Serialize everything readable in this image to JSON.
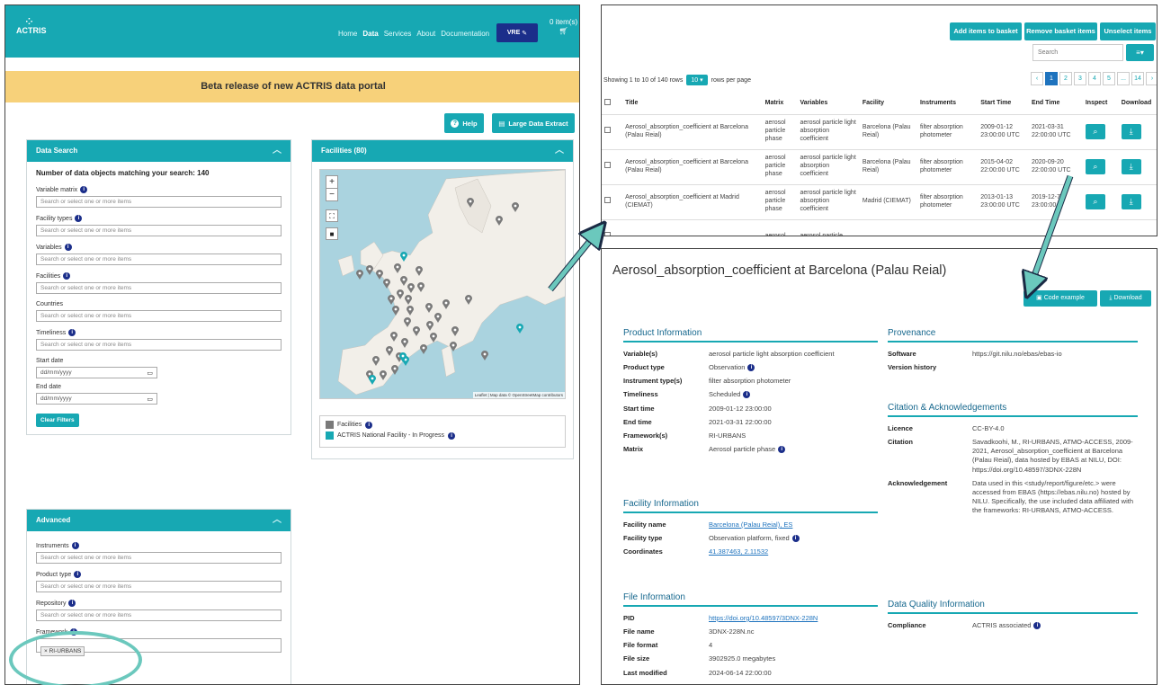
{
  "portal": {
    "logo": "ACTRIS",
    "nav": [
      "Home",
      "Data",
      "Services",
      "About",
      "Documentation"
    ],
    "active_nav": "Data",
    "vre_label": "VRE",
    "basket_label": "0 item(s)",
    "banner": "Beta release of new ACTRIS data portal",
    "help_label": "Help",
    "large_extract_label": "Large Data Extract",
    "search_panel": {
      "title": "Data Search",
      "count_text": "Number of data objects matching your search: 140",
      "fields": [
        {
          "label": "Variable matrix",
          "placeholder": "Search or select one or more items"
        },
        {
          "label": "Facility types",
          "placeholder": "Search or select one or more items"
        },
        {
          "label": "Variables",
          "placeholder": "Search or select one or more items"
        },
        {
          "label": "Facilities",
          "placeholder": "Search or select one or more items"
        },
        {
          "label": "Countries",
          "placeholder": "Search or select one or more items"
        },
        {
          "label": "Timeliness",
          "placeholder": "Search or select one or more items"
        }
      ],
      "start_label": "Start date",
      "end_label": "End date",
      "date_placeholder": "dd/mm/yyyy",
      "clear_label": "Clear Filters"
    },
    "advanced_panel": {
      "title": "Advanced",
      "fields": [
        {
          "label": "Instruments",
          "placeholder": "Search or select one or more items"
        },
        {
          "label": "Product type",
          "placeholder": "Search or select one or more items"
        },
        {
          "label": "Repository",
          "placeholder": "Search or select one or more items"
        }
      ],
      "framework_label": "Framework",
      "framework_tag": "RI-URBANS"
    },
    "facilities_panel": {
      "title": "Facilities (80)",
      "legend": [
        {
          "label": "Facilities",
          "color": "#7a7a7a"
        },
        {
          "label": "ACTRIS National Facility - In Progress",
          "color": "#17a8b3"
        }
      ],
      "attribution": "Leaflet | Map data © OpenStreetMap contributors"
    }
  },
  "table": {
    "buttons": [
      "Add items to basket",
      "Remove basket items",
      "Unselect items"
    ],
    "search_placeholder": "Search",
    "showing_prefix": "Showing 1 to 10 of 140 rows",
    "rows_per_page": "10",
    "rows_suffix": "rows per page",
    "pages": [
      "‹",
      "1",
      "2",
      "3",
      "4",
      "5",
      "...",
      "14",
      "›"
    ],
    "current_page": "1",
    "columns": [
      "Title",
      "Matrix",
      "Variables",
      "Facility",
      "Instruments",
      "Start Time",
      "End Time",
      "Inspect",
      "Download"
    ],
    "rows": [
      [
        "Aerosol_absorption_coefficient at Barcelona (Palau Reial)",
        "aerosol particle phase",
        "aerosol particle light absorption coefficient",
        "Barcelona (Palau Reial)",
        "filter absorption photometer",
        "2009-01-12 23:00:00 UTC",
        "2021-03-31 22:00:00 UTC"
      ],
      [
        "Aerosol_absorption_coefficient at Barcelona (Palau Reial)",
        "aerosol particle phase",
        "aerosol particle light absorption coefficient",
        "Barcelona (Palau Reial)",
        "filter absorption photometer",
        "2015-04-02 22:00:00 UTC",
        "2020-09-20 22:00:00 UTC"
      ],
      [
        "Aerosol_absorption_coefficient at Madrid (CIEMAT)",
        "aerosol particle phase",
        "aerosol particle light absorption coefficient",
        "Madrid (CIEMAT)",
        "filter absorption photometer",
        "2013-01-13 23:00:00 UTC",
        "2019-12-7 23:00:00"
      ],
      [
        "",
        "aerosol",
        "aerosol particle",
        "",
        "",
        "",
        ""
      ]
    ]
  },
  "detail": {
    "title": "Aerosol_absorption_coefficient at Barcelona (Palau Reial)",
    "code_example_label": "Code example",
    "download_label": "Download",
    "product": {
      "heading": "Product Information",
      "items": [
        {
          "k": "Variable(s)",
          "v": "aerosol particle light absorption coefficient"
        },
        {
          "k": "Product type",
          "v": "Observation"
        },
        {
          "k": "Instrument type(s)",
          "v": "filter absorption photometer"
        },
        {
          "k": "Timeliness",
          "v": "Scheduled"
        },
        {
          "k": "Start time",
          "v": "2009-01-12 23:00:00"
        },
        {
          "k": "End time",
          "v": "2021-03-31 22:00:00"
        },
        {
          "k": "Framework(s)",
          "v": "RI-URBANS"
        },
        {
          "k": "Matrix",
          "v": "Aerosol particle phase"
        }
      ]
    },
    "facility": {
      "heading": "Facility Information",
      "items": [
        {
          "k": "Facility name",
          "v": "Barcelona (Palau Reial), ES"
        },
        {
          "k": "Facility type",
          "v": "Observation platform, fixed"
        },
        {
          "k": "Coordinates",
          "v": "41.387463, 2.11532"
        }
      ]
    },
    "file": {
      "heading": "File Information",
      "items": [
        {
          "k": "PID",
          "v": "https://doi.org/10.48597/3DNX-228N"
        },
        {
          "k": "File name",
          "v": "3DNX-228N.nc"
        },
        {
          "k": "File format",
          "v": "4"
        },
        {
          "k": "File size",
          "v": "3902925.0 megabytes"
        },
        {
          "k": "Last modified",
          "v": "2024-06-14 22:00:00"
        }
      ]
    },
    "provenance": {
      "heading": "Provenance",
      "items": [
        {
          "k": "Software",
          "v": "https://git.nilu.no/ebas/ebas-io"
        },
        {
          "k": "Version history",
          "v": ""
        }
      ]
    },
    "citation": {
      "heading": "Citation & Acknowledgements",
      "items": [
        {
          "k": "Licence",
          "v": "CC-BY-4.0"
        },
        {
          "k": "Citation",
          "v": "Savadkoohi, M., RI-URBANS, ATMO-ACCESS, 2009-2021, Aerosol_absorption_coefficient at Barcelona (Palau Reial), data hosted by EBAS at NILU, DOI: https://doi.org/10.48597/3DNX-228N"
        },
        {
          "k": "Acknowledgement",
          "v": "Data used in this <study/report/figure/etc.> were accessed from EBAS (https://ebas.nilu.no) hosted by NILU. Specifically, the use included data affiliated with the frameworks: RI-URBANS, ATMO-ACCESS."
        }
      ]
    },
    "quality": {
      "heading": "Data Quality Information",
      "items": [
        {
          "k": "Compliance",
          "v": "ACTRIS associated"
        }
      ]
    }
  },
  "colors": {
    "accent": "#17a8b3",
    "navy": "#1b2e8a",
    "banner": "#f7d17a",
    "highlight": "#6bc8bd"
  }
}
